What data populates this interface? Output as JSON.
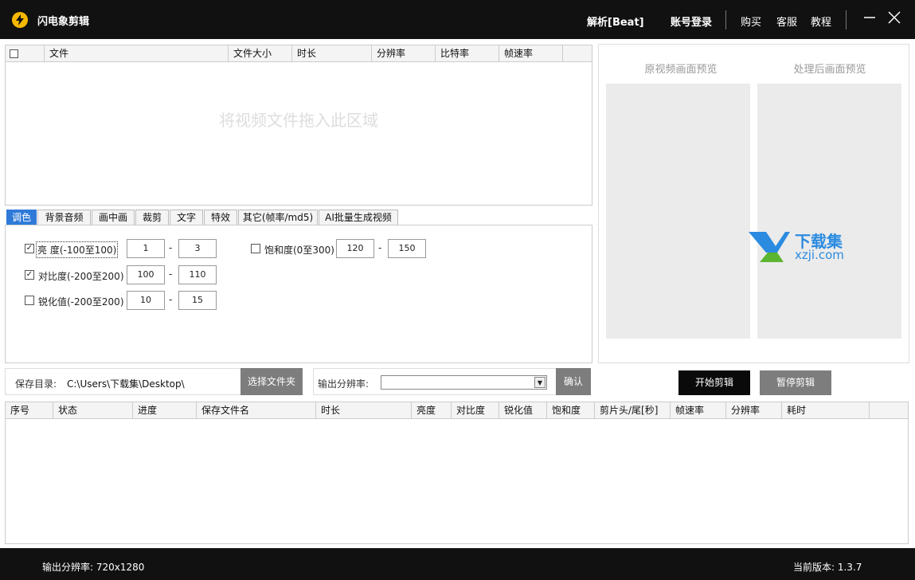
{
  "titlebar": {
    "app_title": "闪电象剪辑",
    "analyze": "解析[Beat]",
    "login": "账号登录",
    "buy": "购买",
    "support": "客服",
    "tutorial": "教程"
  },
  "file_list": {
    "columns": [
      "文件",
      "文件大小",
      "时长",
      "分辨率",
      "比特率",
      "帧速率"
    ],
    "drop_hint": "将视频文件拖入此区域"
  },
  "tabs": [
    "调色",
    "背景音频",
    "画中画",
    "裁剪",
    "文字",
    "特效",
    "其它(帧率/md5)",
    "AI批量生成视频"
  ],
  "color_options": {
    "brightness": {
      "label": "亮   度(-100至100)",
      "checked": true,
      "min": "1",
      "max": "3"
    },
    "contrast": {
      "label": "对比度(-200至200)",
      "checked": true,
      "min": "100",
      "max": "110"
    },
    "sharpness": {
      "label": "锐化值(-200至200)",
      "checked": false,
      "min": "10",
      "max": "15"
    },
    "saturation": {
      "label": "饱和度(0至300)",
      "checked": false,
      "min": "120",
      "max": "150"
    },
    "dash": "-"
  },
  "save": {
    "label": "保存目录:",
    "path": "C:\\Users\\下载集\\Desktop\\",
    "choose_button": "选择文件夹"
  },
  "output_res": {
    "label": "输出分辨率:",
    "value": "",
    "confirm_button": "确认"
  },
  "preview": {
    "original": "原视频画面预览",
    "processed": "处理后画面预览",
    "watermark_line1": "下载集",
    "watermark_line2": "xzji.com"
  },
  "actions": {
    "start": "开始剪辑",
    "pause": "暂停剪辑"
  },
  "task_list": {
    "columns": [
      "序号",
      "状态",
      "进度",
      "保存文件名",
      "时长",
      "亮度",
      "对比度",
      "锐化值",
      "饱和度",
      "剪片头/尾[秒]",
      "帧速率",
      "分辨率",
      "耗时"
    ]
  },
  "statusbar": {
    "output_res": "输出分辨率: 720x1280",
    "version": "当前版本: 1.3.7"
  },
  "colors": {
    "accent": "#2f7ad8",
    "logo": "#f5b800",
    "titlebar": "#111111",
    "gray_button": "#7d7d7d"
  }
}
